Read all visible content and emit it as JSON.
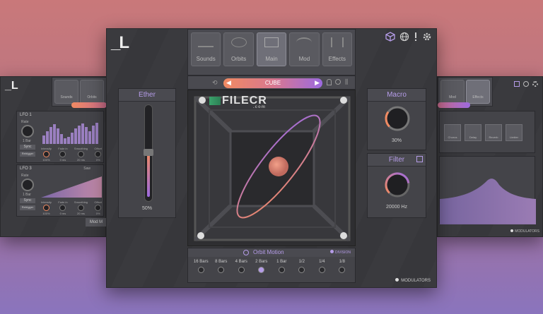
{
  "main": {
    "tabs": [
      {
        "label": "Sounds",
        "icon": "sounds-icon"
      },
      {
        "label": "Orbits",
        "icon": "orbits-icon"
      },
      {
        "label": "Main",
        "icon": "main-icon"
      },
      {
        "label": "Mod",
        "icon": "mod-icon"
      },
      {
        "label": "Effects",
        "icon": "effects-icon"
      }
    ],
    "preset": "CUBE",
    "ether": {
      "title": "Ether",
      "value": "50%",
      "level": 0.5
    },
    "macro": {
      "title": "Macro",
      "value": "30%",
      "level": 0.3
    },
    "filter": {
      "title": "Filter",
      "value": "20000 Hz",
      "level": 0.8
    },
    "orbit_motion": {
      "title": "Orbit Motion",
      "division_label": "DIVISION",
      "divisions": [
        "16 Bars",
        "8 Bars",
        "4 Bars",
        "2 Bars",
        "1 Bar",
        "1/2",
        "1/4",
        "1/8"
      ],
      "selected": 3
    },
    "watermark": "FILECR",
    "watermark_sub": ".com",
    "footer": "MODULATORS"
  },
  "left": {
    "tabs": [
      "Sounds",
      "Orbits"
    ],
    "lfo1": {
      "title": "LFO 1",
      "rate_label": "Rate",
      "rate_value": "1 Bar",
      "knobs": [
        "Intensity",
        "Fade in",
        "Smoothing",
        "Offset"
      ],
      "knob_values": [
        "100%",
        "0 ms",
        "20 ms",
        "0%"
      ],
      "buttons": [
        "Sync",
        "Retrigger"
      ]
    },
    "lfo3": {
      "title": "LFO 3",
      "shape": "Saw",
      "rate_label": "Rate",
      "rate_value": "1 Bar",
      "knobs": [
        "Intensity",
        "Fade in",
        "Smoothing",
        "Offset"
      ],
      "knob_values": [
        "100%",
        "0 ms",
        "20 ms",
        "0%"
      ],
      "buttons": [
        "Sync",
        "Retrigger"
      ]
    },
    "mod_button": "Mod M"
  },
  "right": {
    "tabs": [
      "Mod",
      "Effects"
    ],
    "fx": [
      "Chorus",
      "Delay",
      "Reverb",
      "Limiter"
    ],
    "footer": "MODULATORS"
  },
  "colors": {
    "accent_orange": "#f08a62",
    "accent_purple": "#9c6ae0",
    "panel": "#3a3a3e"
  }
}
